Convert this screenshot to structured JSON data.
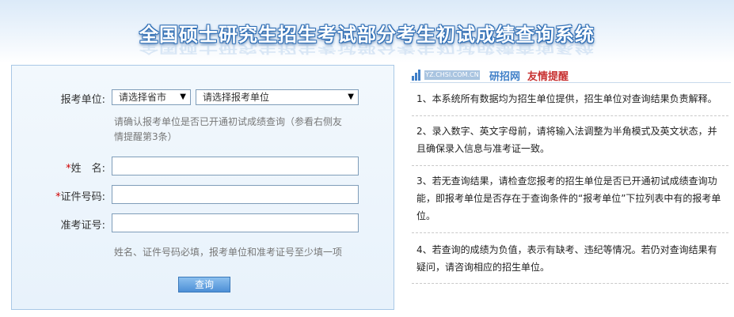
{
  "header": {
    "title": "全国硕士研究生招生考试部分考生初试成绩查询系统"
  },
  "form": {
    "unit_label": "报考单位:",
    "province_select": "请选择省市",
    "unit_select": "请选择报考单位",
    "unit_hint_line1": "请确认报考单位是否已开通初试成绩查询（参看右侧友",
    "unit_hint_line2": "情提醒第3条）",
    "required_mark": "*",
    "name_label": "姓　名:",
    "id_label": "证件号码:",
    "ticket_label": "准考证号:",
    "name_value": "",
    "id_value": "",
    "ticket_value": "",
    "bottom_hint": "姓名、证件号码必填，报考单位和准考证号至少填一项",
    "query_button": "查询"
  },
  "tips": {
    "site_text": "YZ.CHSI.COM.CN",
    "title_part1": "研招网",
    "title_part2": "友情提醒",
    "items": [
      "1、本系统所有数据均为招生单位提供，招生单位对查询结果负责解释。",
      "2、录入数字、英文字母前，请将输入法调整为半角模式及英文状态，并且确保录入信息与准考证一致。",
      "3、若无查询结果，请检查您报考的招生单位是否已开通初试成绩查询功能，即报考单位是否存在于查询条件的“报考单位”下拉列表中有的报考单位。",
      "4、若查询的成绩为负值，表示有缺考、违纪等情况。若仍对查询结果有疑问，请咨询相应的招生单位。"
    ]
  },
  "colors": {
    "accent": "#3f7fc8",
    "required": "#d00000",
    "panel_border": "#a9c8e6"
  }
}
